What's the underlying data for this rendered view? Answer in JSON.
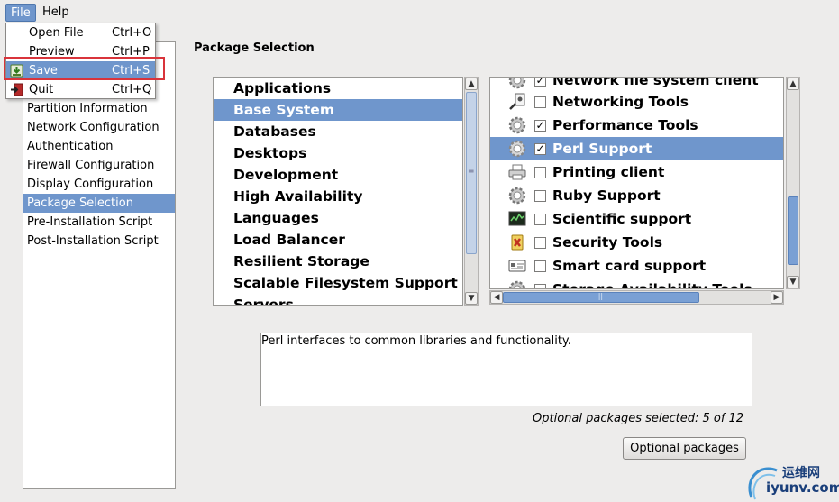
{
  "menubar": {
    "items": [
      {
        "label": "File",
        "active": true
      },
      {
        "label": "Help",
        "active": false
      }
    ]
  },
  "file_menu": {
    "items": [
      {
        "label": "Open File",
        "shortcut": "Ctrl+O",
        "icon": "",
        "highlighted": false
      },
      {
        "label": "Preview",
        "shortcut": "Ctrl+P",
        "icon": "",
        "highlighted": false
      },
      {
        "label": "Save",
        "shortcut": "Ctrl+S",
        "icon": "save-icon",
        "highlighted": true
      },
      {
        "label": "Quit",
        "shortcut": "Ctrl+Q",
        "icon": "quit-icon",
        "highlighted": false
      }
    ]
  },
  "sidebar": {
    "items": [
      {
        "label": "Partition Information",
        "selected": false
      },
      {
        "label": "Network Configuration",
        "selected": false
      },
      {
        "label": "Authentication",
        "selected": false
      },
      {
        "label": "Firewall Configuration",
        "selected": false
      },
      {
        "label": "Display Configuration",
        "selected": false
      },
      {
        "label": "Package Selection",
        "selected": true
      },
      {
        "label": "Pre-Installation Script",
        "selected": false
      },
      {
        "label": "Post-Installation Script",
        "selected": false
      }
    ]
  },
  "main": {
    "title": "Package Selection",
    "categories": [
      {
        "label": "Applications",
        "selected": false
      },
      {
        "label": "Base System",
        "selected": true
      },
      {
        "label": "Databases",
        "selected": false
      },
      {
        "label": "Desktops",
        "selected": false
      },
      {
        "label": "Development",
        "selected": false
      },
      {
        "label": "High Availability",
        "selected": false
      },
      {
        "label": "Languages",
        "selected": false
      },
      {
        "label": "Load Balancer",
        "selected": false
      },
      {
        "label": "Resilient Storage",
        "selected": false
      },
      {
        "label": "Scalable Filesystem Support",
        "selected": false
      },
      {
        "label": "Servers",
        "selected": false
      }
    ],
    "packages": [
      {
        "label": "Network file system client",
        "checked": true,
        "selected": false,
        "icon": "gear-icon"
      },
      {
        "label": "Networking Tools",
        "checked": false,
        "selected": false,
        "icon": "network-tools-icon"
      },
      {
        "label": "Performance Tools",
        "checked": true,
        "selected": false,
        "icon": "gear-icon"
      },
      {
        "label": "Perl Support",
        "checked": true,
        "selected": true,
        "icon": "gear-icon"
      },
      {
        "label": "Printing client",
        "checked": false,
        "selected": false,
        "icon": "printer-icon"
      },
      {
        "label": "Ruby Support",
        "checked": false,
        "selected": false,
        "icon": "gear-icon"
      },
      {
        "label": "Scientific support",
        "checked": false,
        "selected": false,
        "icon": "monitor-chart-icon"
      },
      {
        "label": "Security Tools",
        "checked": false,
        "selected": false,
        "icon": "security-icon"
      },
      {
        "label": "Smart card support",
        "checked": false,
        "selected": false,
        "icon": "smart-card-icon"
      },
      {
        "label": "Storage Availability Tools",
        "checked": false,
        "selected": false,
        "icon": "gear-icon"
      }
    ],
    "description": "Perl interfaces to common libraries and functionality.",
    "optional_count": "Optional packages selected: 5 of 12",
    "optional_button": "Optional packages",
    "check_mark": "✓",
    "scroll_glyphs": {
      "up": "▲",
      "down": "▼",
      "left": "◀",
      "right": "▶",
      "grip_v": "≡",
      "grip_h": "|||"
    }
  },
  "watermark": {
    "top": "运维网",
    "bottom": "iyunv.com"
  }
}
